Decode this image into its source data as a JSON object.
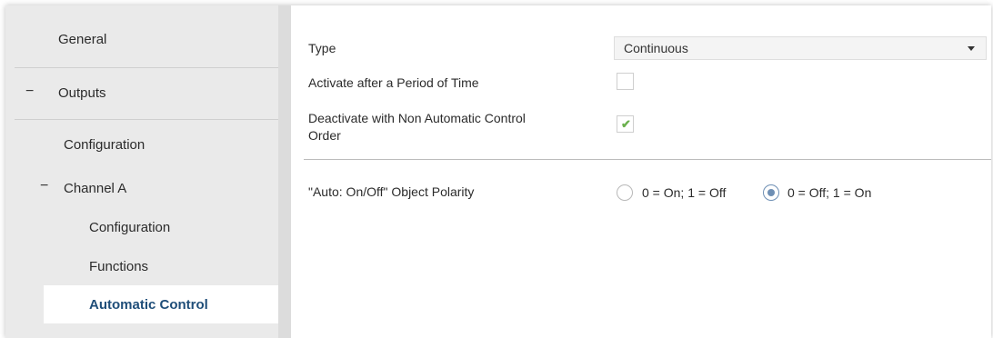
{
  "sidebar": {
    "general": "General",
    "outputs": "Outputs",
    "outputs_toggle": "−",
    "configuration": "Configuration",
    "channel_a": "Channel A",
    "channel_a_toggle": "−",
    "channel_configuration": "Configuration",
    "functions": "Functions",
    "automatic_control": "Automatic Control"
  },
  "main": {
    "type_label": "Type",
    "type_value": "Continuous",
    "activate_label": "Activate after a Period of Time",
    "activate_checked": false,
    "deactivate_label_line1": "Deactivate with Non Automatic Control",
    "deactivate_label_line2": "Order",
    "deactivate_checked": true,
    "polarity_label": "\"Auto: On/Off\" Object Polarity",
    "polarity_options": [
      "0 = On; 1 = Off",
      "0 = Off; 1 = On"
    ],
    "polarity_selected": 1
  },
  "colors": {
    "selected_nav_text": "#1f4e79",
    "check_color": "#6ab04c",
    "radio_selected": "#6e8fb4"
  }
}
